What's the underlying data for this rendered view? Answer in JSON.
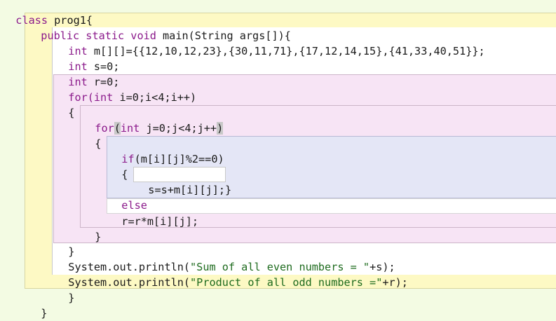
{
  "editor": {
    "background_color": "#f3fbe3",
    "method_block_color": "#fdf9c4",
    "for_block_color": "#f7e4f5",
    "if_block_color": "#e4e6f6",
    "keyword_color": "#8b1a8b",
    "string_color": "#1e6b1e",
    "lines": [
      {
        "kw": "class",
        "rest": " prog1{"
      },
      {
        "kw": "public static void",
        "rest": " main(String args[]){"
      },
      {
        "kw": "int",
        "rest": " m[][]={{12,10,12,23},{30,11,71},{17,12,14,15},{41,33,40,51}};"
      },
      {
        "kw": "int",
        "rest": " s=0;"
      },
      {
        "kw": "int",
        "rest": " r=0;"
      },
      {
        "kw": "for(int",
        "rest": " i=0;i<4;i++)"
      },
      {
        "text": "{"
      },
      {
        "kw_a": "for",
        "paren_open": "(",
        "kw_b": "int",
        "middle": " j=0;j<4;j++",
        "paren_close": ")"
      },
      {
        "text": "{"
      },
      {
        "kw": "if",
        "rest": "(m[i][j]%2==0)"
      },
      {
        "text": "{"
      },
      {
        "text": "s=s+m[i][j];}"
      },
      {
        "kw": "else",
        "rest": ""
      },
      {
        "text": "r=r*m[i][j];"
      },
      {
        "text": "}"
      },
      {
        "text": "}"
      },
      {
        "pre": "System.out.println(",
        "str": "\"Sum of all even numbers = \"",
        "post": "+s);"
      },
      {
        "pre": "System.out.println(",
        "str": "\"Product of all odd numbers =\"",
        "post": "+r);"
      },
      {
        "text": "}"
      },
      {
        "text": "}"
      }
    ]
  }
}
